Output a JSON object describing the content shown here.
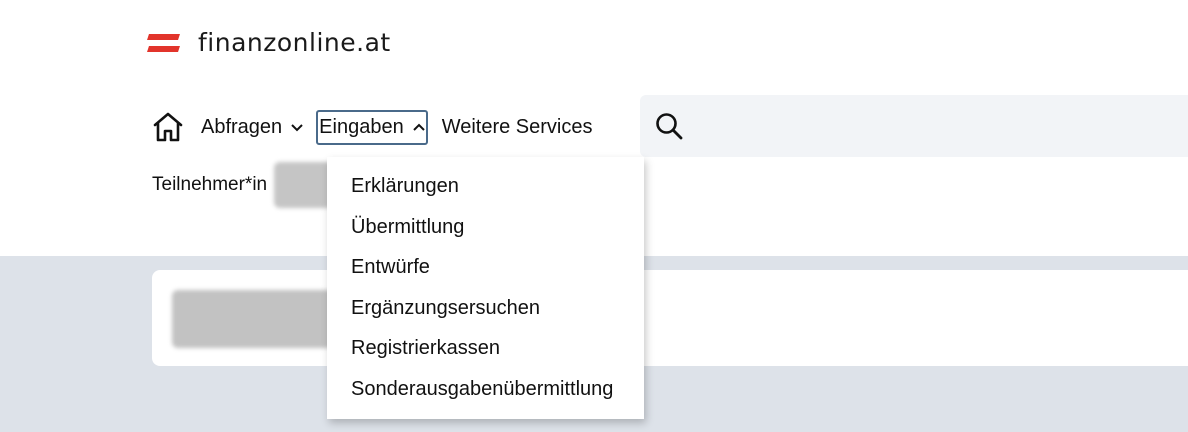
{
  "brand": {
    "name": "finanzonline.at",
    "flag_color": "#e2342b"
  },
  "nav": {
    "home_icon": "home-icon",
    "items": [
      {
        "label": "Abfragen",
        "chevron": "down"
      },
      {
        "label": "Eingaben",
        "chevron": "up",
        "expanded": true
      },
      {
        "label": "Weitere Services"
      }
    ]
  },
  "search": {
    "icon": "search-icon",
    "value": "",
    "placeholder": ""
  },
  "participant": {
    "label": "Teilnehmer*in"
  },
  "dropdown": {
    "items": [
      "Erklärungen",
      "Übermittlung",
      "Entwürfe",
      "Ergänzungsersuchen",
      "Registrierkassen",
      "Sonderausgabenübermittlung"
    ]
  },
  "colors": {
    "band_background": "#dde2e9",
    "search_background": "#f2f4f7",
    "focus_border": "#4a6a8a"
  }
}
